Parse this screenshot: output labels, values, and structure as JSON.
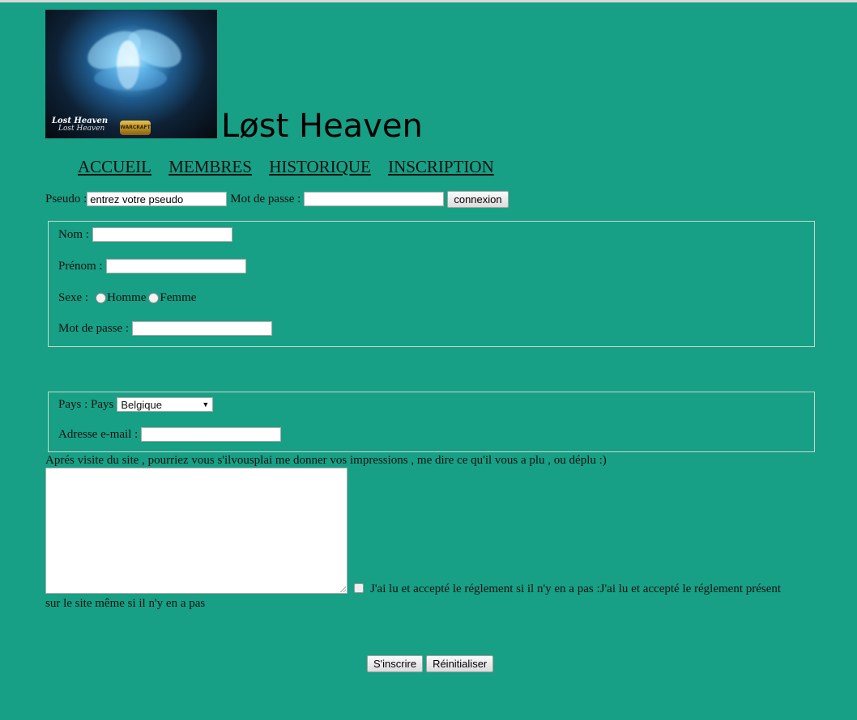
{
  "site": {
    "title": "Løst Heaven"
  },
  "logo": {
    "text_line1": "Lost Heaven",
    "text_line2": "Lost Heaven",
    "badge": "WARCRAFT"
  },
  "nav": [
    {
      "label": "ACCUEIL"
    },
    {
      "label": "MEMBRES"
    },
    {
      "label": "HISTORIQUE"
    },
    {
      "label": "INSCRIPTION"
    }
  ],
  "login": {
    "pseudo_label": "Pseudo :",
    "pseudo_value": "entrez votre pseudo",
    "password_label": "Mot de passe :",
    "password_value": "",
    "button": "connexion"
  },
  "identity": {
    "nom_label": "Nom :",
    "prenom_label": "Prénom :",
    "sexe_label": "Sexe :",
    "homme_label": "Homme",
    "femme_label": "Femme",
    "password_label": "Mot de passe :"
  },
  "location": {
    "pays_label": "Pays : Pays",
    "pays_selected": "Belgique",
    "email_label": "Adresse e-mail :"
  },
  "feedback": {
    "question": "Aprés visite du site , pourriez vous s'ilvousplai me donner vos impressions , me dire ce qu'il vous a plu , ou déplu :)",
    "rules_line1": "J'ai lu et accepté le réglement si il n'y en a pas :J'ai lu et accepté le réglement présent",
    "rules_line2": "sur le site même si il n'y en a pas"
  },
  "actions": {
    "submit": "S'inscrire",
    "reset": "Réinitialiser"
  },
  "colors": {
    "background": "#17a085"
  }
}
